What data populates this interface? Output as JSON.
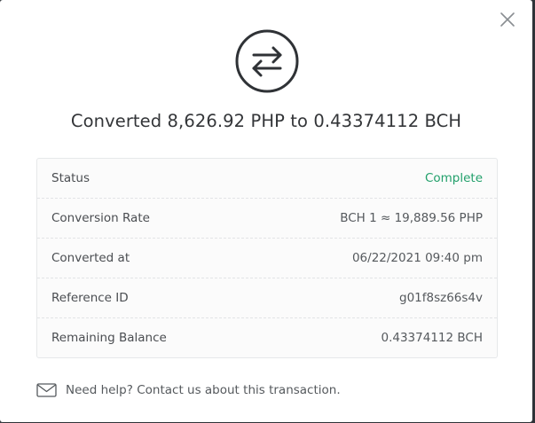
{
  "modal": {
    "close_icon": "close-icon",
    "hero_icon": "swap-arrows-icon",
    "title": "Converted 8,626.92 PHP to 0.43374112 BCH"
  },
  "details": {
    "rows": [
      {
        "label": "Status",
        "value": "Complete"
      },
      {
        "label": "Conversion Rate",
        "value": "BCH 1 ≈ 19,889.56 PHP"
      },
      {
        "label": "Converted at",
        "value": "06/22/2021 09:40 pm"
      },
      {
        "label": "Reference ID",
        "value": "g01f8sz66s4v"
      },
      {
        "label": "Remaining Balance",
        "value": "0.43374112 BCH"
      }
    ]
  },
  "help": {
    "icon": "mail-icon",
    "text": "Need help? Contact us about this transaction."
  },
  "colors": {
    "status_complete": "#22a06b",
    "text_primary": "#333538",
    "text_secondary": "#55595d"
  }
}
